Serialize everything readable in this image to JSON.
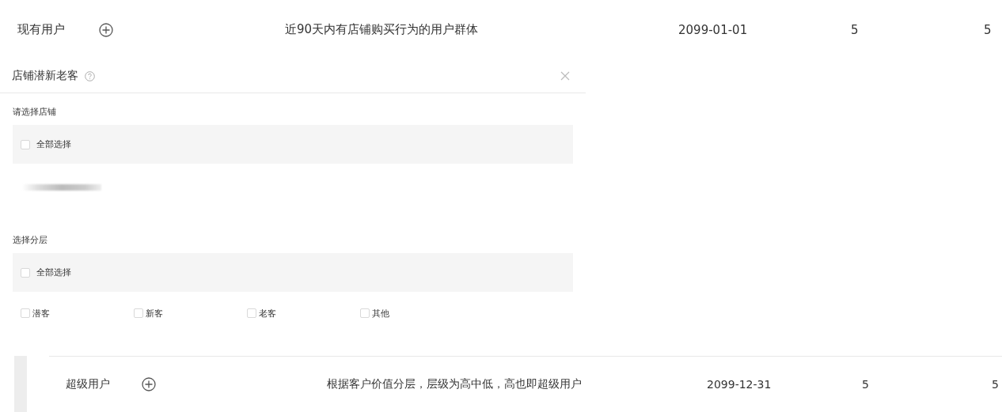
{
  "rows": [
    {
      "name": "现有用户",
      "description": "近90天内有店铺购买行为的用户群体",
      "date": "2099-01-01",
      "column_4": "5",
      "column_5": "5"
    },
    {
      "name": "超级用户",
      "description": "根据客户价值分层，层级为高中低，高也即超级用户",
      "date": "2099-12-31",
      "column_4": "5",
      "column_5": "5"
    }
  ],
  "panel": {
    "title": "店铺潜新老客",
    "sections": [
      {
        "label": "请选择店铺",
        "select_all": {
          "label": "全部选择",
          "checked": false
        },
        "options": [
          {
            "kind": "redacted"
          }
        ]
      },
      {
        "label": "选择分层",
        "select_all": {
          "label": "全部选择",
          "checked": false
        },
        "options": [
          {
            "kind": "checkbox",
            "label": "潜客",
            "checked": false
          },
          {
            "kind": "checkbox",
            "label": "新客",
            "checked": false
          },
          {
            "kind": "checkbox",
            "label": "老客",
            "checked": false
          },
          {
            "kind": "checkbox",
            "label": "其他",
            "checked": false
          }
        ]
      }
    ]
  }
}
